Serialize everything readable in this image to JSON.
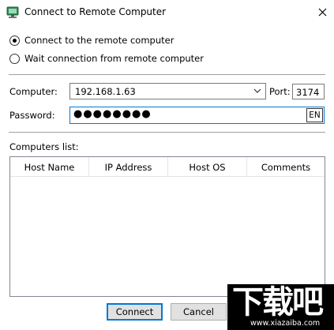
{
  "window": {
    "title": "Connect to Remote Computer",
    "close_glyph": "✕"
  },
  "mode": {
    "option_connect": "Connect to the remote computer",
    "option_wait": "Wait connection from remote computer",
    "selected": "connect"
  },
  "form": {
    "computer_label": "Computer:",
    "computer_value": "192.168.1.63",
    "port_label": "Port:",
    "port_value": "3174",
    "password_label": "Password:",
    "password_mask": "●●●●●●●●",
    "input_lang": "EN"
  },
  "computers_list": {
    "label": "Computers list:",
    "columns": [
      "Host Name",
      "IP Address",
      "Host OS",
      "Comments"
    ],
    "rows": []
  },
  "buttons": {
    "connect": "Connect",
    "cancel": "Cancel"
  },
  "watermark": {
    "glyphs": "下载吧",
    "url": "www.xiazaiba.com"
  },
  "colors": {
    "focus_accent": "#0078d7",
    "button_face": "#e1e1e1",
    "separator": "#a0a0a0"
  }
}
